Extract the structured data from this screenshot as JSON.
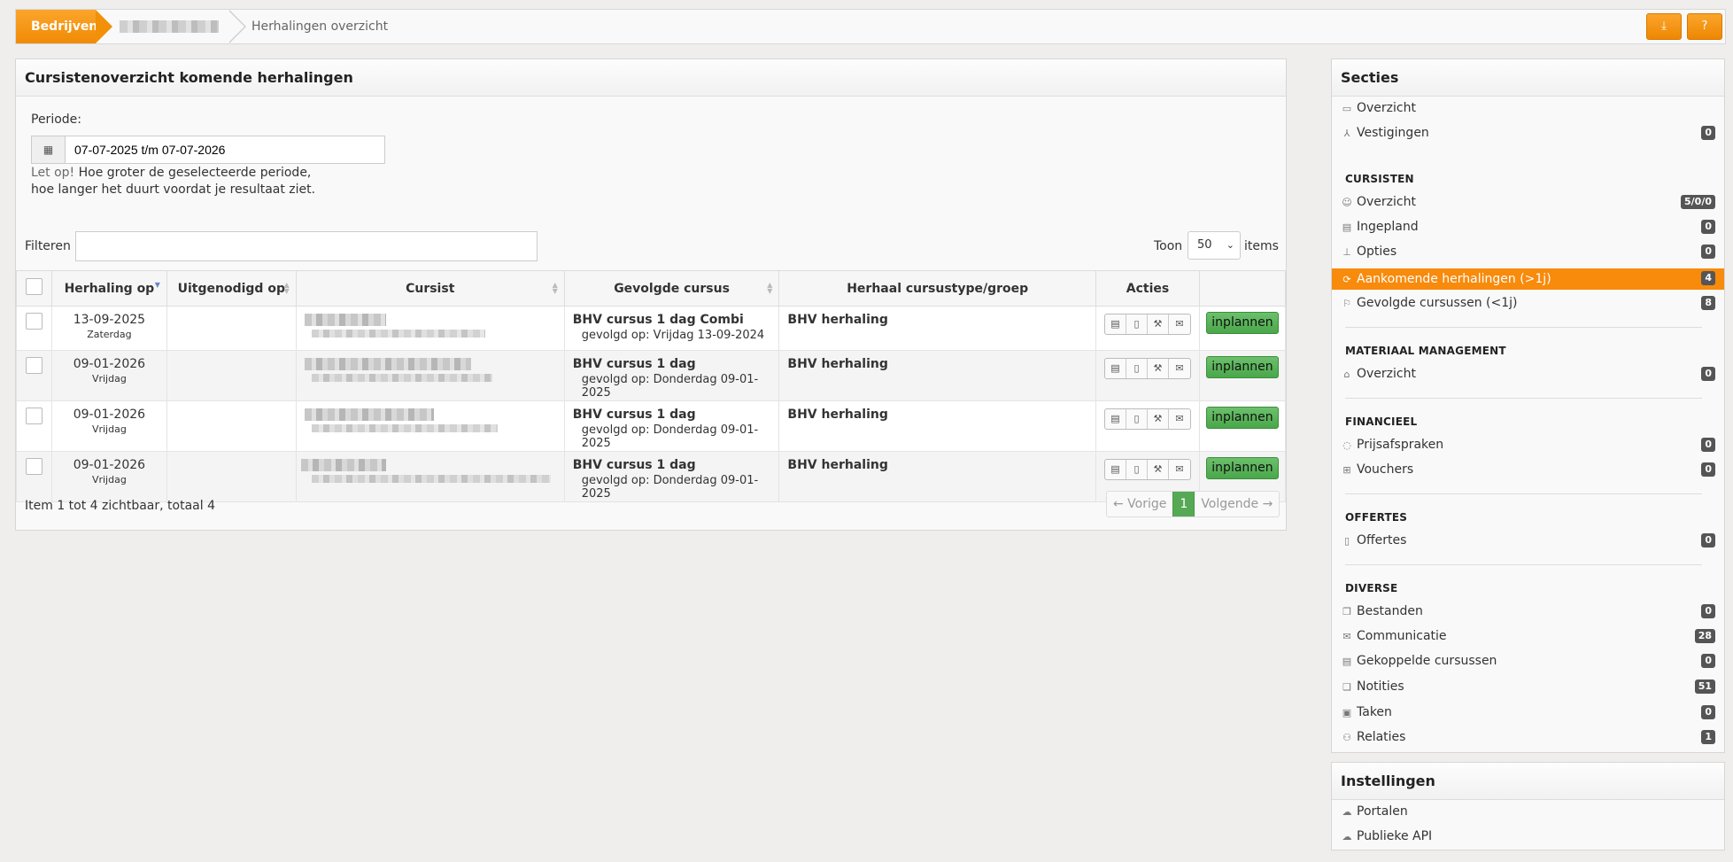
{
  "breadcrumb": {
    "first": "Bedrijven",
    "current": "Herhalingen overzicht"
  },
  "toolbar": {
    "download_icon": "download-icon",
    "help_icon": "question-circle-icon",
    "accent": "#f08b04"
  },
  "main": {
    "title": "Cursistenoverzicht komende herhalingen",
    "periode_label": "Periode:",
    "periode_value": "07-07-2025 t/m 07-07-2026",
    "hint_warn": "Let op!",
    "hint_rest": " Hoe groter de geselecteerde periode,",
    "hint_line2": "hoe langer het duurt voordat je resultaat ziet.",
    "filter_label": "Filteren",
    "filter_value": "",
    "toon_label": "Toon",
    "toon_value": "50",
    "items_label": "items",
    "columns": [
      "Herhaling op",
      "Uitgenodigd op",
      "Cursist",
      "Gevolgde cursus",
      "Herhaal cursustype/groep",
      "Acties"
    ],
    "rows": [
      {
        "date": "13-09-2025",
        "day": "Zaterdag",
        "invited": "",
        "course": "BHV cursus 1 dag Combi",
        "followed": "gevolgd op: Vrijdag 13-09-2024",
        "repeat": "BHV herhaling",
        "action": "inplannen"
      },
      {
        "date": "09-01-2026",
        "day": "Vrijdag",
        "invited": "",
        "course": "BHV cursus 1 dag",
        "followed": "gevolgd op: Donderdag 09-01-2025",
        "repeat": "BHV herhaling",
        "action": "inplannen"
      },
      {
        "date": "09-01-2026",
        "day": "Vrijdag",
        "invited": "",
        "course": "BHV cursus 1 dag",
        "followed": "gevolgd op: Donderdag 09-01-2025",
        "repeat": "BHV herhaling",
        "action": "inplannen"
      },
      {
        "date": "09-01-2026",
        "day": "Vrijdag",
        "invited": "",
        "course": "BHV cursus 1 dag",
        "followed": "gevolgd op: Donderdag 09-01-2025",
        "repeat": "BHV herhaling",
        "action": "inplannen"
      }
    ],
    "summary": "Item 1 tot 4 zichtbaar, totaal 4",
    "pager": {
      "prev": "← Vorige",
      "page": "1",
      "next": "Volgende →"
    }
  },
  "sidebar": {
    "title": "Secties",
    "items": [
      {
        "label": "Overzicht",
        "badge": "",
        "icon": "folder-icon"
      },
      {
        "label": "Vestigingen",
        "badge": "0",
        "icon": "sitemap-icon"
      },
      {
        "label": "Overzicht",
        "badge": "5/0/0",
        "icon": "users-icon"
      },
      {
        "label": "Ingepland",
        "badge": "0",
        "icon": "list-icon"
      },
      {
        "label": "Opties",
        "badge": "0",
        "icon": "pin-icon"
      },
      {
        "label": "Aankomende herhalingen (>1j)",
        "badge": "4",
        "icon": "refresh-icon"
      },
      {
        "label": "Gevolgde cursussen (<1j)",
        "badge": "8",
        "icon": "certificate-icon"
      },
      {
        "label": "Overzicht",
        "badge": "0",
        "icon": "toolbox-icon"
      },
      {
        "label": "Prijsafspraken",
        "badge": "0",
        "icon": "comments-icon"
      },
      {
        "label": "Vouchers",
        "badge": "0",
        "icon": "gift-icon"
      },
      {
        "label": "Offertes",
        "badge": "0",
        "icon": "file-icon"
      },
      {
        "label": "Bestanden",
        "badge": "0",
        "icon": "files-icon"
      },
      {
        "label": "Communicatie",
        "badge": "28",
        "icon": "envelope-icon"
      },
      {
        "label": "Gekoppelde cursussen",
        "badge": "0",
        "icon": "list-icon"
      },
      {
        "label": "Notities",
        "badge": "51",
        "icon": "notes-icon"
      },
      {
        "label": "Taken",
        "badge": "0",
        "icon": "clipboard-icon"
      },
      {
        "label": "Relaties",
        "badge": "1",
        "icon": "people-icon"
      }
    ],
    "sections": [
      "CURSISTEN",
      "MATERIAAL MANAGEMENT",
      "FINANCIEEL",
      "OFFERTES",
      "DIVERSE"
    ]
  },
  "settings": {
    "title": "Instellingen",
    "items": [
      {
        "label": "Portalen",
        "icon": "cloud-icon"
      },
      {
        "label": "Publieke API",
        "icon": "cloud-icon"
      }
    ]
  }
}
